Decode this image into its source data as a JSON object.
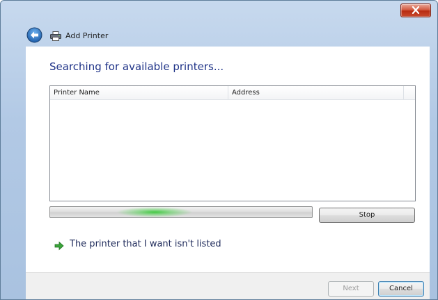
{
  "window": {
    "title": "Add Printer"
  },
  "main": {
    "heading": "Searching for available printers...",
    "list": {
      "columns": [
        "Printer Name",
        "Address"
      ],
      "rows": []
    },
    "progress": {
      "state": "indeterminate"
    },
    "stop_label": "Stop",
    "link_text": "The printer that I want isn't listed"
  },
  "footer": {
    "next_label": "Next",
    "cancel_label": "Cancel"
  },
  "icons": {
    "close": "close-icon",
    "back": "back-arrow-icon",
    "printer": "printer-icon",
    "link": "green-arrow-icon"
  },
  "colors": {
    "heading": "#1e3287",
    "close_button": "#c84a2e",
    "progress_glow": "#3cc83c"
  }
}
